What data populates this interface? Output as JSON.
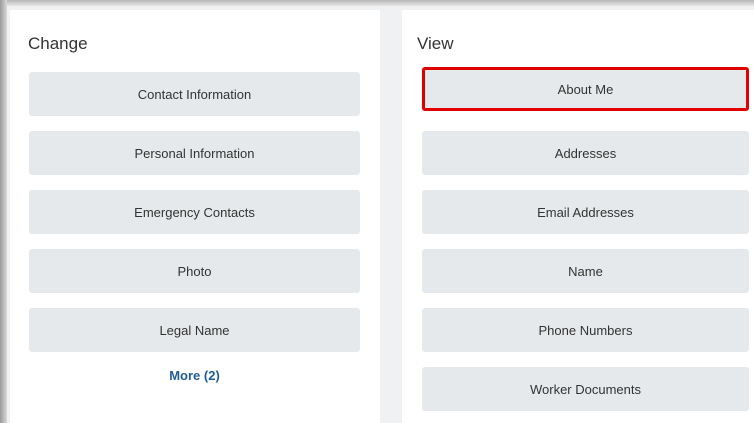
{
  "change": {
    "title": "Change",
    "buttons": [
      "Contact Information",
      "Personal Information",
      "Emergency Contacts",
      "Photo",
      "Legal Name"
    ],
    "more_label": "More (2)"
  },
  "view": {
    "title": "View",
    "buttons": [
      "About Me",
      "Addresses",
      "Email Addresses",
      "Name",
      "Phone Numbers",
      "Worker Documents"
    ],
    "highlighted": "About Me"
  },
  "colors": {
    "button_bg": "#e6e9eb",
    "highlight_border": "#e00000",
    "link": "#1f5d96"
  }
}
